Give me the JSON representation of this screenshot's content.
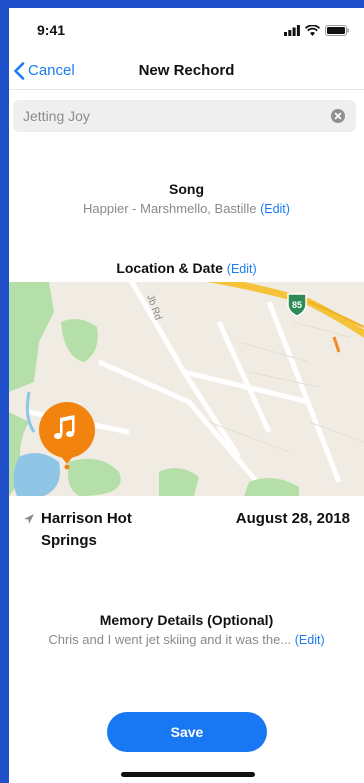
{
  "status": {
    "time": "9:41"
  },
  "nav": {
    "cancel_label": "Cancel",
    "title": "New Rechord"
  },
  "search": {
    "value": "Jetting Joy"
  },
  "song": {
    "heading": "Song",
    "detail": "Happier - Marshmello, Bastille",
    "edit_label": "(Edit)"
  },
  "location": {
    "heading": "Location & Date",
    "edit_label": "(Edit)",
    "place_line1": "Harrison Hot",
    "place_line2": "Springs",
    "date": "August 28, 2018"
  },
  "map": {
    "road_label": "Jb Rd",
    "highway_shield": "85",
    "pin_icon": "music-note-icon"
  },
  "memory": {
    "heading": "Memory Details (Optional)",
    "detail": "Chris and I went jet skiing and it was the...",
    "edit_label": "(Edit)"
  },
  "save_label": "Save",
  "colors": {
    "accent": "#1a7cf5",
    "save_button": "#1877f2",
    "pin": "#f2830f",
    "highway": "#f5c23a",
    "park": "#b5dfa8",
    "water": "#8fc6e6",
    "frame": "#1f4fc9"
  }
}
